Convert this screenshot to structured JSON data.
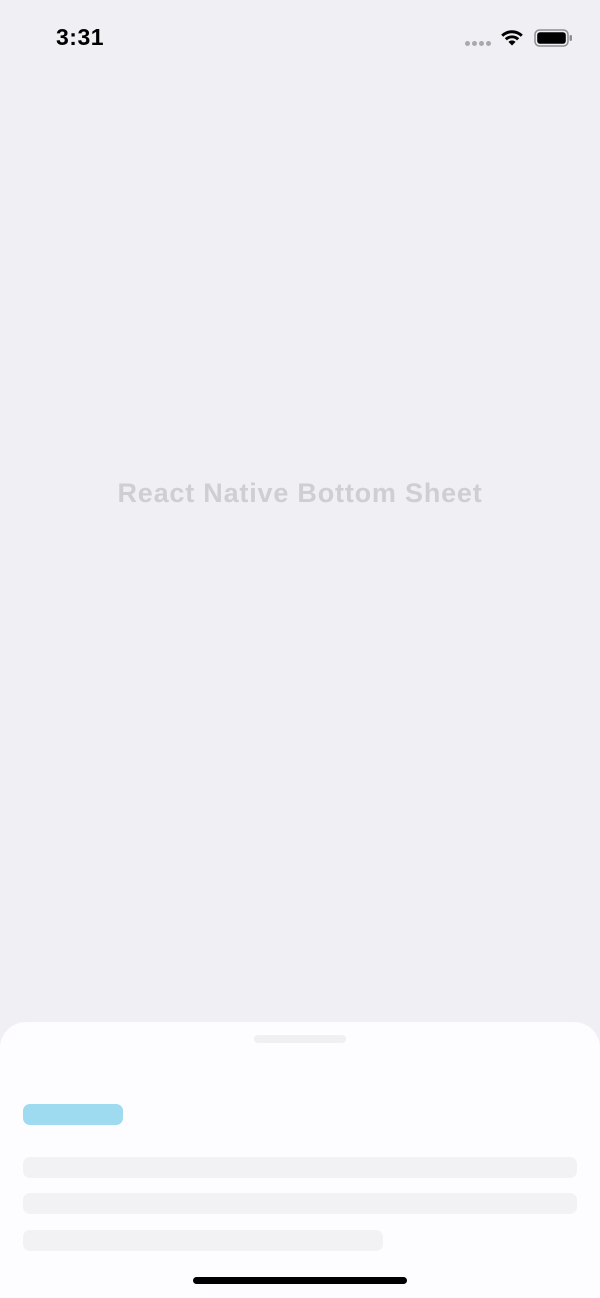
{
  "status_bar": {
    "time": "3:31",
    "signal_icon": "cellular-signal-dots-icon",
    "wifi_icon": "wifi-icon",
    "battery_icon": "battery-icon"
  },
  "main": {
    "title": "React Native Bottom Sheet"
  },
  "bottom_sheet": {
    "handle_icon": "drag-handle-icon",
    "colors": {
      "background": "#fdfcff",
      "handle": "#f0f0f3",
      "accent_placeholder": "#9edbf0",
      "line_placeholder": "#f2f1f4"
    },
    "placeholder_lines": 3
  },
  "colors": {
    "screen_background": "#f0eff3",
    "title_text": "#cfced3"
  }
}
